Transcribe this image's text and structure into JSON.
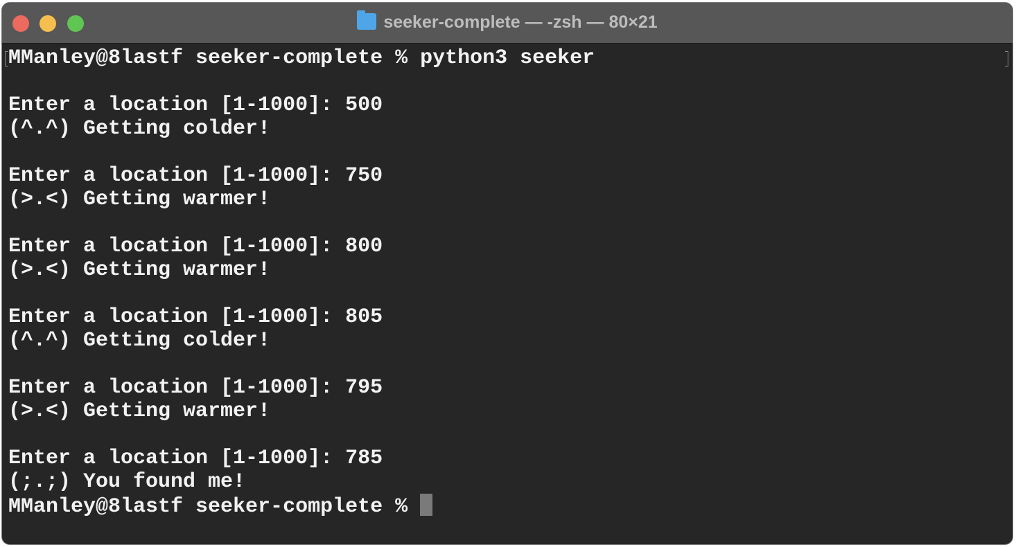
{
  "window": {
    "title": "seeker-complete — -zsh — 80×21",
    "title_icon": "folder-icon"
  },
  "terminal": {
    "lines": [
      "MManley@8lastf seeker-complete % python3 seeker",
      "",
      "Enter a location [1-1000]: 500",
      "(^.^) Getting colder!",
      "",
      "Enter a location [1-1000]: 750",
      "(>.<) Getting warmer!",
      "",
      "Enter a location [1-1000]: 800",
      "(>.<) Getting warmer!",
      "",
      "Enter a location [1-1000]: 805",
      "(^.^) Getting colder!",
      "",
      "Enter a location [1-1000]: 795",
      "(>.<) Getting warmer!",
      "",
      "Enter a location [1-1000]: 785",
      "(;.;) You found me!"
    ],
    "prompt": "MManley@8lastf seeker-complete % "
  }
}
